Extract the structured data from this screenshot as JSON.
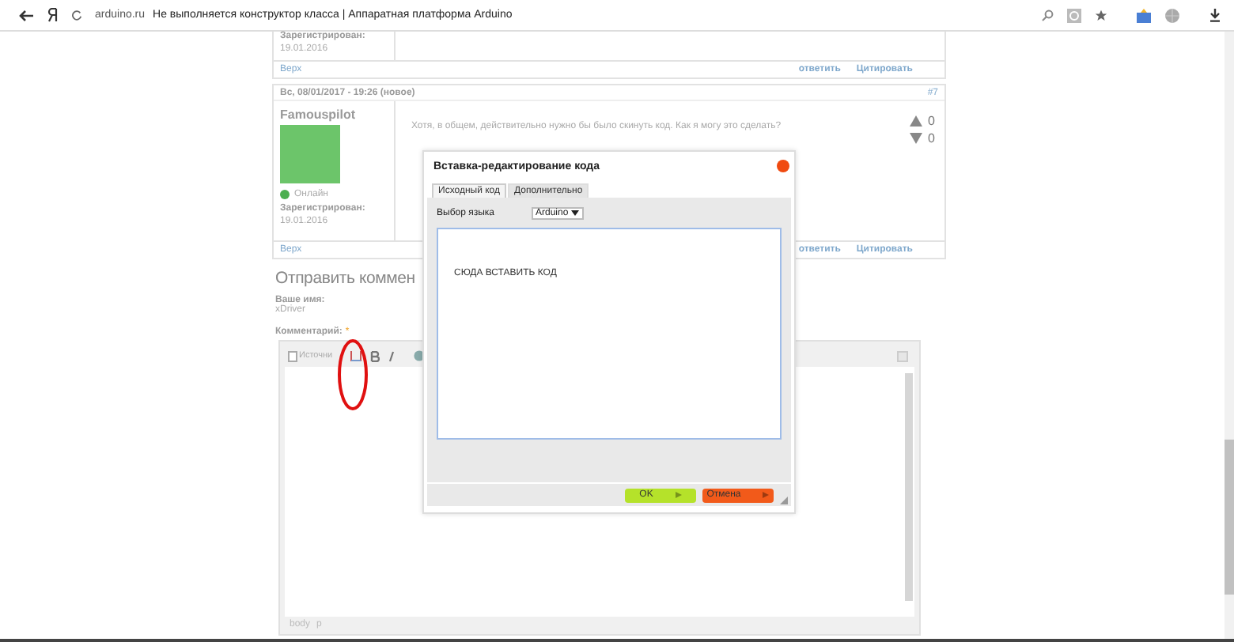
{
  "browser": {
    "domain": "arduino.ru",
    "title": "Не выполняется конструктор класса | Аппаратная платформа Arduino"
  },
  "prev_post": {
    "registered_label": "Зарегистрирован:",
    "registered_date": "19.01.2016",
    "top_link": "Верх",
    "reply_link": "ответить",
    "quote_link": "Цитировать"
  },
  "post": {
    "date": "Вс, 08/01/2017 - 19:26 (новое)",
    "number": "#7",
    "author": "Famouspilot",
    "online": true,
    "status": "Онлайн",
    "registered_label": "Зарегистрирован:",
    "registered_date": "19.01.2016",
    "text": "Хотя, в общем, действительно нужно бы было скинуть код. Как я могу это сделать?",
    "votes_up": "0",
    "votes_down": "0",
    "top_link": "Верх",
    "reply_link": "ответить",
    "quote_link": "Цитировать"
  },
  "comment_form": {
    "heading": "Отправить коммен",
    "name_label": "Ваше имя:",
    "name_value": "xDriver",
    "comment_label": "Комментарий:",
    "required_mark": "*",
    "toolbar_source": "Источни",
    "status_path": [
      "body",
      "p"
    ]
  },
  "dialog": {
    "title": "Вставка-редактирование кода",
    "tabs": [
      {
        "label": "Исходный код",
        "selected": true
      },
      {
        "label": "Дополнительно",
        "selected": false
      }
    ],
    "language_label": "Выбор языка",
    "language_value": "Arduino",
    "code": "СЮДА ВСТАВИТЬ КОД",
    "buttons": [
      {
        "label": "OK",
        "kind": "ok"
      },
      {
        "label": "Отмена",
        "kind": "cancel"
      }
    ]
  }
}
